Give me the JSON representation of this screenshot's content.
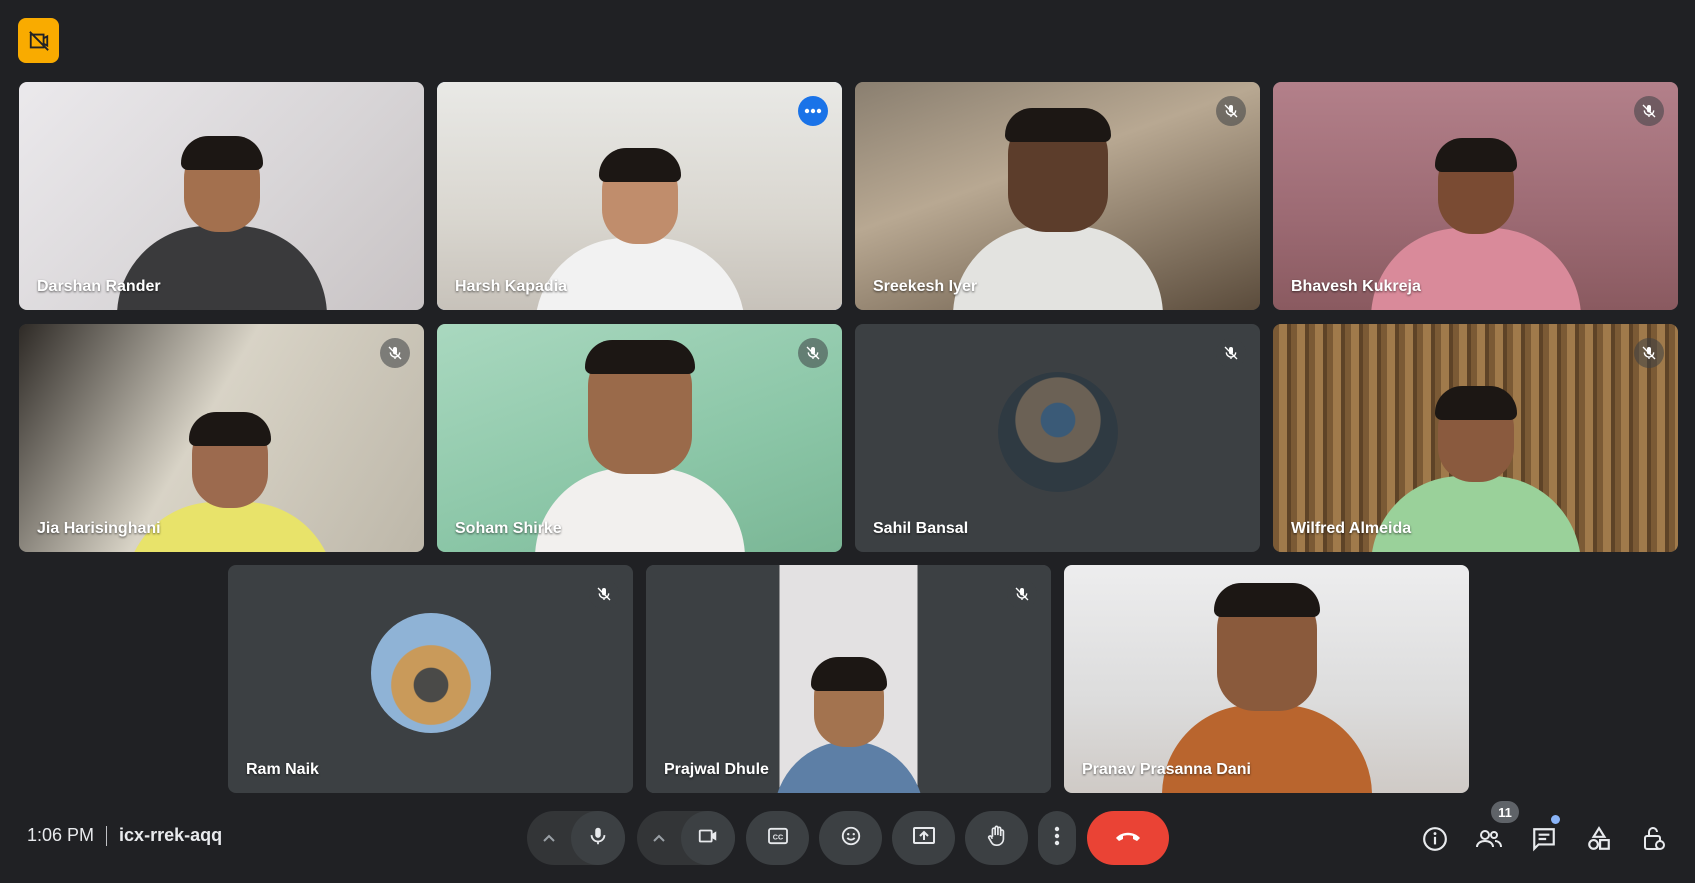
{
  "meeting": {
    "time": "1:06 PM",
    "code": "icx-rrek-aqq"
  },
  "participants": [
    {
      "name": "Darshan Rander",
      "muted": false
    },
    {
      "name": "Harsh Kapadia",
      "muted": false,
      "active_speaker": true
    },
    {
      "name": "Sreekesh Iyer",
      "muted": true
    },
    {
      "name": "Bhavesh Kukreja",
      "muted": true
    },
    {
      "name": "Jia Harisinghani",
      "muted": true
    },
    {
      "name": "Soham Shirke",
      "muted": true
    },
    {
      "name": "Sahil Bansal",
      "muted": true,
      "avatar_only": true
    },
    {
      "name": "Wilfred Almeida",
      "muted": true
    },
    {
      "name": "Ram Naik",
      "muted": true,
      "avatar_only": true
    },
    {
      "name": "Prajwal Dhule",
      "muted": true
    },
    {
      "name": "Pranav Prasanna Dani",
      "muted": false
    }
  ],
  "people_count": "11",
  "icons": {
    "top_badge": "camera-off-icon",
    "mic": "microphone-icon",
    "camera": "video-camera-icon",
    "captions": "captions-icon",
    "emoji": "emoji-icon",
    "present": "present-screen-icon",
    "hand": "raise-hand-icon",
    "more": "more-options-icon",
    "hangup": "end-call-icon",
    "info": "info-icon",
    "people": "people-icon",
    "chat": "chat-icon",
    "activities": "activities-icon",
    "host_controls": "host-controls-icon"
  },
  "colors": {
    "background": "#202124",
    "tile": "#3c4043",
    "accent": "#8ab4f8",
    "hangup": "#ea4335",
    "badge": "#f9ab00"
  }
}
